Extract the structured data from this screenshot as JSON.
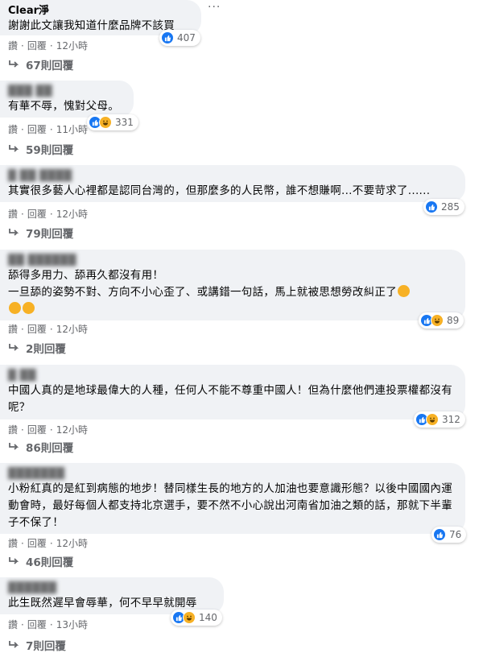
{
  "actions": {
    "like": "讚",
    "reply": "回覆",
    "dot": "·"
  },
  "colors": {
    "like": "#1877f2",
    "haha": "#f7b125",
    "bubble": "#f0f2f5",
    "meta": "#65676b"
  },
  "comments": [
    {
      "author": "Clear淨",
      "text": "謝謝此文讓我知道什麼品牌不該買",
      "reaction_icons": [
        "like-icon"
      ],
      "reaction_count": "407",
      "time": "12小時",
      "replies": "67則回覆"
    },
    {
      "author": "",
      "text": "有華不辱，愧對父母。",
      "reaction_icons": [
        "like-icon",
        "haha-icon"
      ],
      "reaction_count": "331",
      "time": "11小時",
      "replies": "59則回覆"
    },
    {
      "author": "",
      "text": "其實很多藝人心裡都是認同台灣的，但那麼多的人民幣，誰不想賺啊...不要苛求了......",
      "reaction_icons": [
        "like-icon"
      ],
      "reaction_count": "285",
      "time": "12小時",
      "replies": "79則回覆"
    },
    {
      "author": "",
      "text_line1": "舔得多用力、舔再久都沒有用！",
      "text_line2": "一旦舔的姿勢不對、方向不小心歪了、或講錯一句話，馬上就被思想勞改糾正了",
      "reaction_icons": [
        "like-icon",
        "haha-icon"
      ],
      "reaction_count": "89",
      "time": "12小時",
      "replies": "2則回覆"
    },
    {
      "author": "",
      "text": "中國人真的是地球最偉大的人種，任何人不能不尊重中國人！但為什麼他們連投票權都沒有呢？",
      "reaction_icons": [
        "like-icon",
        "haha-icon"
      ],
      "reaction_count": "312",
      "time": "12小時",
      "replies": "86則回覆"
    },
    {
      "author": "",
      "text": "小粉紅真的是紅到病態的地步！替同樣生長的地方的人加油也要意識形態？以後中國國內運動會時，最好每個人都支持北京選手，要不然不小心說出河南省加油之類的話，那就下半輩子不保了！",
      "reaction_icons": [
        "like-icon"
      ],
      "reaction_count": "76",
      "time": "12小時",
      "replies": "46則回覆"
    },
    {
      "author": "",
      "text": "此生既然遲早會辱華，何不早早就開辱",
      "reaction_icons": [
        "like-icon",
        "haha-icon"
      ],
      "reaction_count": "140",
      "time": "13小時",
      "replies": "7則回覆"
    }
  ]
}
